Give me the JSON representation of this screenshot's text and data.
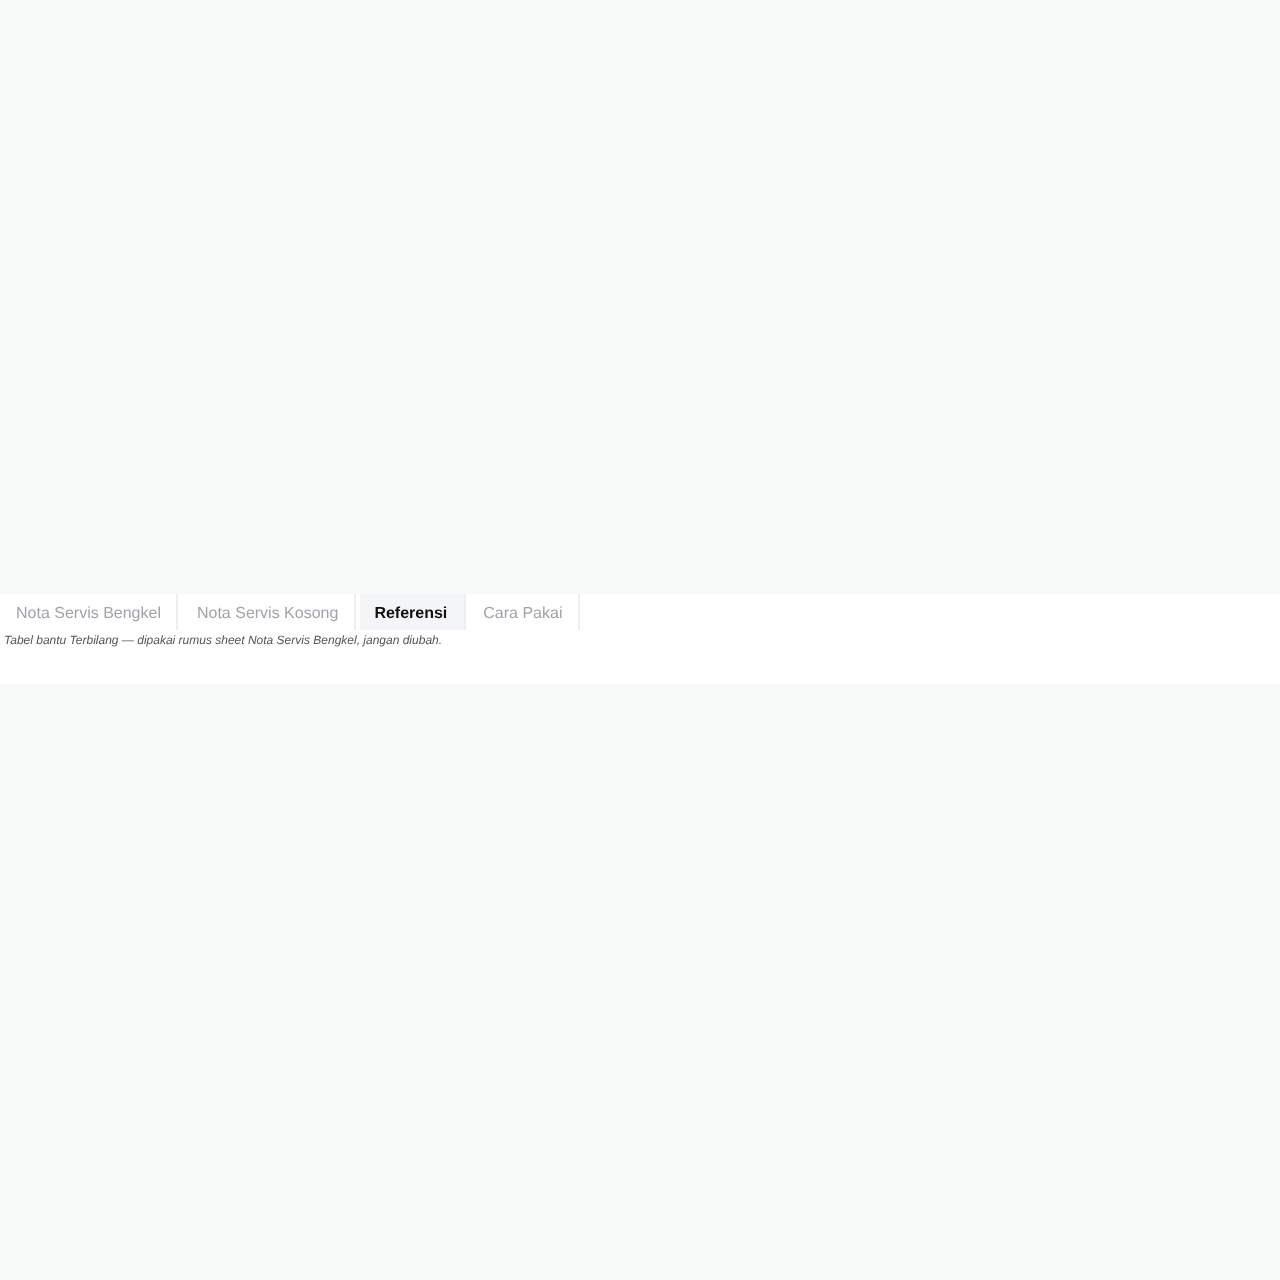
{
  "tabs": [
    {
      "label": "Nota Servis Bengkel",
      "selected": false
    },
    {
      "label": "Nota Servis Kosong",
      "selected": false
    },
    {
      "label": "Referensi",
      "selected": true
    },
    {
      "label": "Cara Pakai",
      "selected": false
    }
  ],
  "note": "Tabel bantu Terbilang — dipakai rumus sheet Nota Servis Bengkel, jangan diubah."
}
